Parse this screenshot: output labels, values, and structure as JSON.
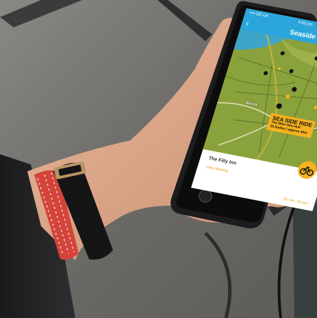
{
  "status_bar": {
    "carrier": "•••• EE-UK",
    "time": "4:45 pm"
  },
  "app": {
    "title": "Seaside",
    "back_icon": "chevron-left-icon",
    "info_icon": "info-icon",
    "location_icon": "locate-icon"
  },
  "map": {
    "place_label": "Brock",
    "ride_card": {
      "title": "SEA SIDE RIDE",
      "line1": "The Bike Hire Hub",
      "line2": "10.5miles / approx 40m"
    }
  },
  "bottom_sheet": {
    "place_name": "The Filly Inn",
    "link": "View Website",
    "duration": "30 min. 48 sec",
    "cycle_icon": "bicycle-icon"
  },
  "colors": {
    "accent": "#f5b21e",
    "map_green": "#8aa23c",
    "header_blue": "#2aa6dc"
  }
}
